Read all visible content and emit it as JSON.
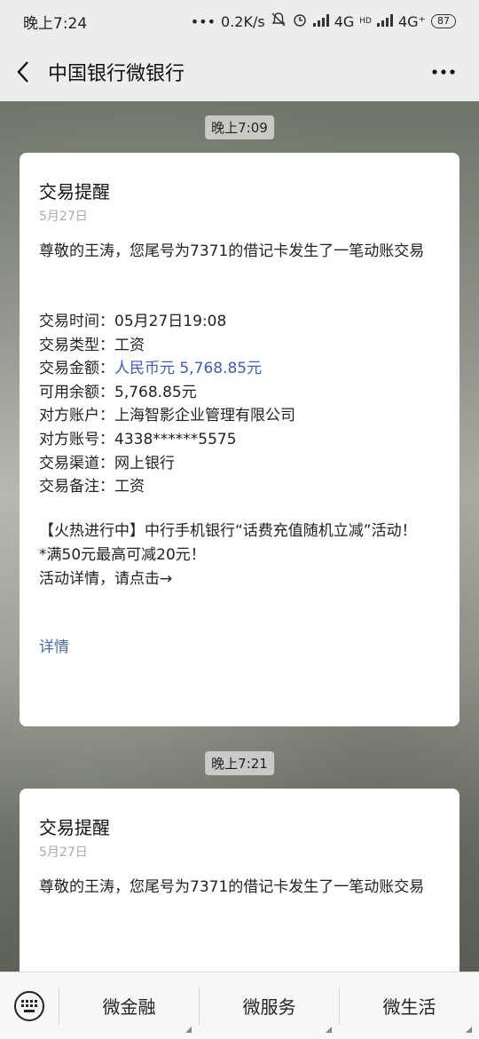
{
  "status": {
    "time": "晚上7:24",
    "dots": "•••",
    "speed": "0.2K/s",
    "network1": "4G",
    "network2": "4G⁺",
    "hd": "HD",
    "battery": "87"
  },
  "nav": {
    "title": "中国银行微银行"
  },
  "messages": [
    {
      "time": "晚上7:09",
      "title": "交易提醒",
      "date": "5月27日",
      "intro": "尊敬的王涛，您尾号为7371的借记卡发生了一笔动账交易",
      "rows": [
        {
          "label": "交易时间：",
          "value": "05月27日19:08"
        },
        {
          "label": "交易类型：",
          "value": "工资"
        },
        {
          "label": "交易金额：",
          "value": "人民币元 5,768.85元"
        },
        {
          "label": "可用余额：",
          "value": "5,768.85元"
        },
        {
          "label": "对方账户：",
          "value": "上海智影企业管理有限公司"
        },
        {
          "label": "对方账号：",
          "value": "4338******5575"
        },
        {
          "label": "交易渠道：",
          "value": "网上银行"
        },
        {
          "label": "交易备注：",
          "value": "工资"
        }
      ],
      "promo": [
        "【火热进行中】中行手机银行“话费充值随机立减”活动！",
        "*满50元最高可减20元！",
        "活动详情，请点击→"
      ],
      "link": "详情"
    },
    {
      "time": "晚上7:21",
      "title": "交易提醒",
      "date": "5月27日",
      "intro": "尊敬的王涛，您尾号为7371的借记卡发生了一笔动账交易"
    }
  ],
  "bottom_menu": [
    "微金融",
    "微服务",
    "微生活"
  ],
  "colors": {
    "highlight": "#3b5bbd",
    "link": "#4a6ab3"
  }
}
